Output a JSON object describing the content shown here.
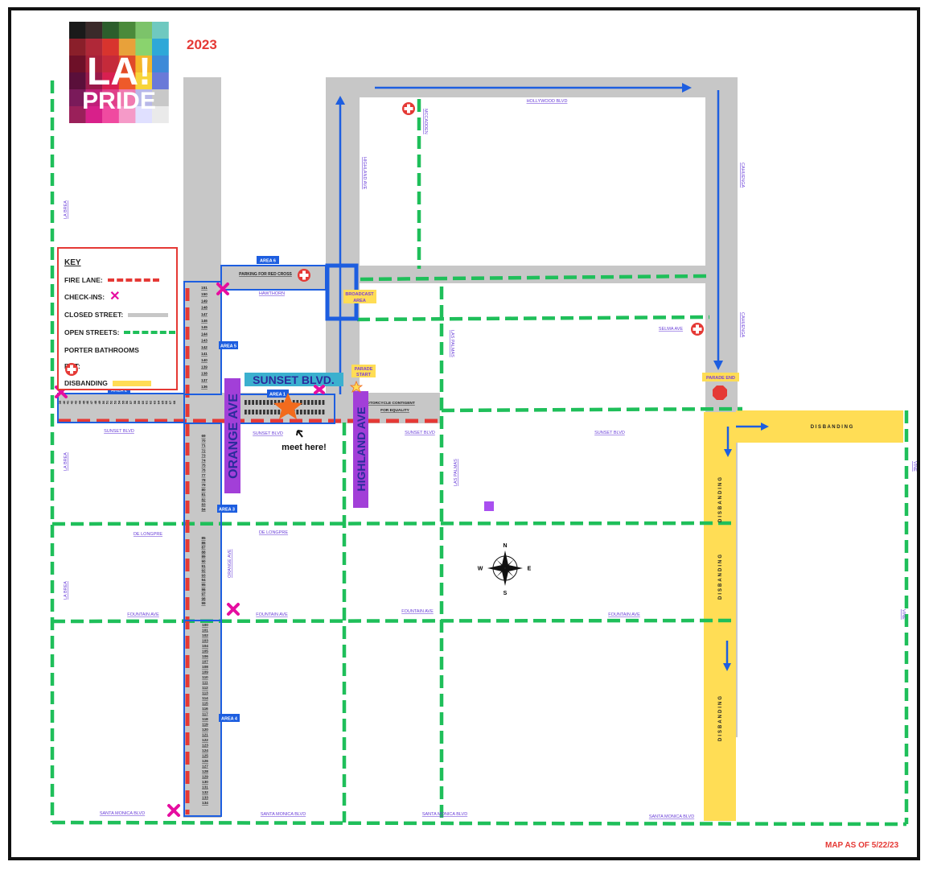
{
  "header": {
    "year": "2023",
    "map_as_of": "MAP AS OF 5/22/23",
    "logo_text_1": "LA!",
    "logo_text_2": "PRIDE"
  },
  "key": {
    "title": "KEY",
    "items": [
      {
        "label": "FIRE LANE:",
        "symbol": "red-dashed-line",
        "color": "#e53935"
      },
      {
        "label": "CHECK-INS:",
        "symbol": "x-mark",
        "color": "#e60da0"
      },
      {
        "label": "CLOSED STREET:",
        "symbol": "gray-line",
        "color": "#c7c7c7"
      },
      {
        "label": "OPEN STREETS:",
        "symbol": "green-dashed-line",
        "color": "#1fbf5a"
      },
      {
        "label": "PORTER BATHROOMS",
        "symbol": "none"
      },
      {
        "label": "EMT:",
        "symbol": "red-cross-icon",
        "color": "#e53935"
      },
      {
        "label": "DISBANDING",
        "symbol": "yellow-bar",
        "color": "#ffdd55"
      }
    ]
  },
  "colors": {
    "closed": "#c7c7c7",
    "open": "#1fbf5a",
    "fire": "#e53935",
    "route": "#1d5ee0",
    "disband": "#ffdd55",
    "highlight": "#a23fd8",
    "checkin": "#e60da0",
    "star": "#f26b1d"
  },
  "streets": {
    "hollywood": "HOLLYWOOD BLVD",
    "mccadden": "MCCADDEN",
    "highland_top": "HIGHLAND AVE",
    "cahuenga_top": "CAHUENGA",
    "cahuenga_mid": "CAHUENGA",
    "la_brea_1": "LA BREA",
    "la_brea_2": "LA BREA",
    "la_brea_3": "LA BREA",
    "hawthorn": "HAWTHORN",
    "selma": "SELMA AVE",
    "las_palmas_1": "LAS PALMAS",
    "las_palmas_2": "LAS PALMAS",
    "sunset_1": "SUNSET BLVD",
    "sunset_2": "SUNSET BLVD",
    "sunset_3": "SUNSET BLVD",
    "sunset_4": "SUNSET BLVD",
    "de_longpre_1": "DE LONGPRE",
    "de_longpre_2": "DE LONGPRE",
    "orange_ave_small": "ORANGE AVE",
    "fountain_1": "FOUNTAIN AVE",
    "fountain_2": "FOUNTAIN AVE",
    "fountain_3": "FOUNTAIN AVE",
    "fountain_4": "FOUNTAIN AVE",
    "santa_monica_1": "SANTA MONICA BLVD",
    "santa_monica_2": "SANTA MONICA BLVD",
    "santa_monica_3": "SANTA MONICA BLVD",
    "santa_monica_4": "SANTA MONICA BLVD",
    "vine_1": "VINE",
    "vine_2": "VINE"
  },
  "areas": {
    "area1": "AREA 1",
    "area2": "AREA 2",
    "area3": "AREA 3",
    "area4": "AREA 4",
    "area5": "AREA 5",
    "area6": "AREA 6"
  },
  "labels": {
    "parking_red_cross": "PARKING FOR RED CROSS",
    "broadcast_1": "BROADCAST",
    "broadcast_2": "AREA",
    "parade_start_1": "PARADE",
    "parade_start_2": "START",
    "parade_end": "PARADE END",
    "sunset_big": "SUNSET BLVD.",
    "orange_big": "ORANGE AVE",
    "highland_big": "HIGHLAND AVE",
    "motorcycle_1": "MOTORCYCLE CONTIGENT",
    "motorcycle_2": "FOR EQUALITY",
    "meet_here": "meet here!",
    "disbanding_h": "D I S B A N D I N G",
    "disbanding_v1": "DISBANDING",
    "disbanding_v2": "DISBANDING",
    "disbanding_v3": "DISBANDING"
  },
  "compass": {
    "n": "N",
    "s": "S",
    "e": "E",
    "w": "W"
  },
  "slots": {
    "area5": [
      "151",
      "150",
      "149",
      "148",
      "147",
      "146",
      "145",
      "144",
      "143",
      "142",
      "141",
      "140",
      "139",
      "138",
      "137",
      "136"
    ],
    "area3": [
      "69",
      "70",
      "71",
      "72",
      "73",
      "74",
      "75",
      "76",
      "77",
      "78",
      "79",
      "80",
      "81",
      "82",
      "83",
      "84"
    ],
    "area3b": [
      "85",
      "86",
      "87",
      "88",
      "89",
      "90",
      "91",
      "92",
      "93",
      "94",
      "95",
      "96",
      "97",
      "98",
      "99"
    ],
    "area4": [
      "100",
      "101",
      "102",
      "103",
      "104",
      "105",
      "106",
      "107",
      "108",
      "109",
      "110",
      "111",
      "112",
      "113",
      "114",
      "115",
      "116",
      "117",
      "118",
      "119",
      "120",
      "121",
      "122",
      "123",
      "124",
      "125",
      "126",
      "127",
      "128",
      "129",
      "130",
      "131",
      "132",
      "133",
      "134"
    ],
    "area2": [
      "68",
      "67",
      "66",
      "65",
      "64",
      "63",
      "62",
      "61",
      "60",
      "59",
      "58",
      "57",
      "56",
      "55",
      "54",
      "53",
      "52",
      "51",
      "50",
      "49",
      "48",
      "47",
      "46",
      "45",
      "44",
      "43",
      "42",
      "41",
      "40",
      "39"
    ]
  }
}
